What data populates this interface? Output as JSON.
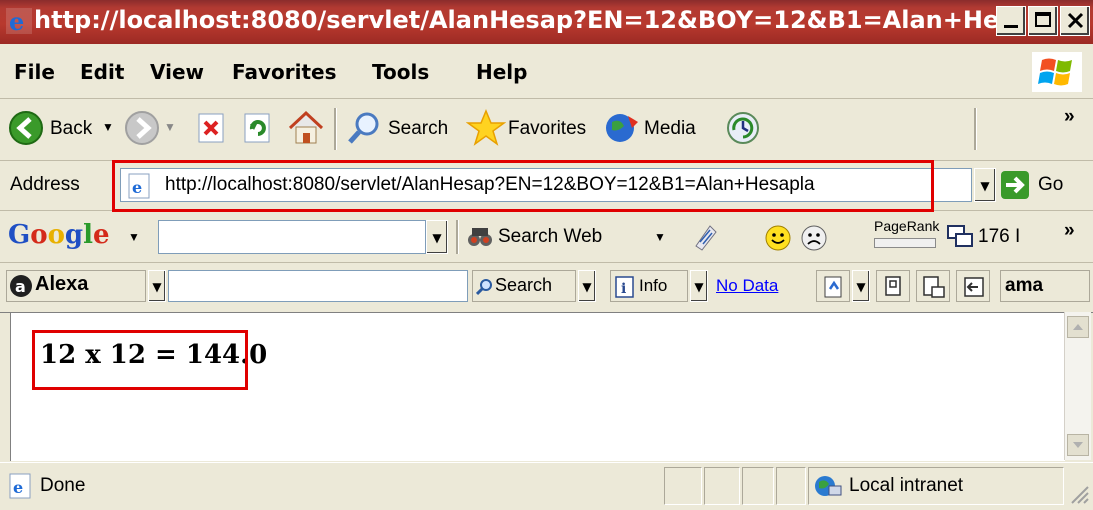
{
  "window": {
    "title": "http://localhost:8080/servlet/AlanHesap?EN=12&BOY=12&B1=Alan+He..."
  },
  "menu": {
    "file": "File",
    "edit": "Edit",
    "view": "View",
    "favorites": "Favorites",
    "tools": "Tools",
    "help": "Help"
  },
  "toolbar": {
    "back": "Back",
    "search": "Search",
    "favorites": "Favorites",
    "media": "Media",
    "more": "»"
  },
  "address": {
    "label": "Address",
    "url": "http://localhost:8080/servlet/AlanHesap?EN=12&BOY=12&B1=Alan+Hesapla",
    "go": "Go"
  },
  "google": {
    "logo": "Google",
    "search_web": "Search Web",
    "pagerank": "PageRank",
    "blocked": "176 I",
    "more": "»"
  },
  "alexa": {
    "logo": "Alexa",
    "search": "Search",
    "info": "Info",
    "no_data": "No Data",
    "amazon": "ama"
  },
  "page": {
    "result": "12 x 12 = 144.0"
  },
  "status": {
    "text": "Done",
    "zone": "Local intranet"
  },
  "colors": {
    "highlight": "#e00000",
    "titlebar": "#b23a32"
  }
}
